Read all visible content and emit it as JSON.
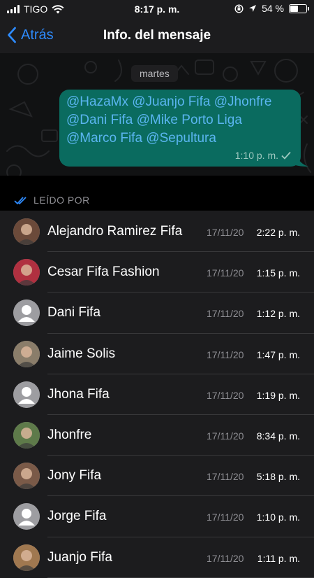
{
  "status_bar": {
    "carrier": "TIGO",
    "time": "8:17 p. m.",
    "battery": "54 %",
    "battery_fraction": 0.54
  },
  "nav": {
    "back_label": "Atrás",
    "title": "Info. del mensaje"
  },
  "chat": {
    "day_label": "martes",
    "message_text": "@HazaMx @Juanjo Fifa  @Jhonfre\n@Dani Fifa  @Mike Porto Liga\n@Marco Fifa @Sepultura",
    "message_time": "1:10 p. m."
  },
  "read_by": {
    "header": "LEÍDO POR",
    "rows": [
      {
        "name": "Alejandro Ramirez Fifa",
        "date": "17/11/20",
        "time": "2:22 p. m.",
        "avatar": "photo-avatar",
        "avatar_color": "#6b4a3a"
      },
      {
        "name": "Cesar Fifa Fashion",
        "date": "17/11/20",
        "time": "1:15 p. m.",
        "avatar": "photo-avatar",
        "avatar_color": "#b03040"
      },
      {
        "name": "Dani Fifa",
        "date": "17/11/20",
        "time": "1:12 p. m.",
        "avatar": "default-avatar"
      },
      {
        "name": "Jaime Solis",
        "date": "17/11/20",
        "time": "1:47 p. m.",
        "avatar": "photo-avatar",
        "avatar_color": "#8a7d6a"
      },
      {
        "name": "Jhona Fifa",
        "date": "17/11/20",
        "time": "1:19 p. m.",
        "avatar": "default-avatar"
      },
      {
        "name": "Jhonfre",
        "date": "17/11/20",
        "time": "8:34 p. m.",
        "avatar": "photo-avatar",
        "avatar_color": "#5e7a4a"
      },
      {
        "name": "Jony Fifa",
        "date": "17/11/20",
        "time": "5:18 p. m.",
        "avatar": "photo-avatar",
        "avatar_color": "#7a5a48"
      },
      {
        "name": "Jorge Fifa",
        "date": "17/11/20",
        "time": "1:10 p. m.",
        "avatar": "default-avatar"
      },
      {
        "name": "Juanjo Fifa",
        "date": "17/11/20",
        "time": "1:11 p. m.",
        "avatar": "photo-avatar",
        "avatar_color": "#a07850"
      }
    ]
  },
  "colors": {
    "accent": "#2e8bfd",
    "bubble": "#0a6b5f",
    "mention": "#5ab5f0",
    "background": "#1c1c1e"
  }
}
